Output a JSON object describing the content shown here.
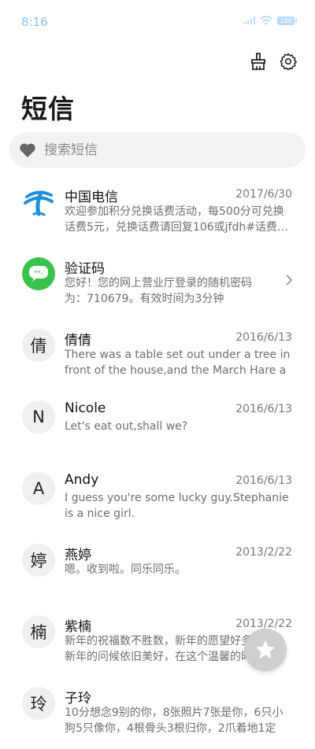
{
  "status_bar": {
    "time": "8:16",
    "battery": "100"
  },
  "page_title": "短信",
  "search": {
    "placeholder": "搜索短信"
  },
  "messages": [
    {
      "name": "中国电信",
      "date": "2017/6/30",
      "preview": "欢迎参加积分兑换话费活动，每500分可兑换话费5元，兑换话费请回复106或jfdh#话费…",
      "avatar_icon": "china-telecom-logo-icon"
    },
    {
      "name": "验证码",
      "date": "",
      "preview": "您好！您的网上营业厅登录的随机密码为：710679。有效时间为3分钟",
      "avatar_icon": "message-bubble-icon"
    },
    {
      "name": "倩倩",
      "date": "2016/6/13",
      "preview": "There was a table set out under a tree in front of the house,and the March Hare an…",
      "avatar_letter": "倩"
    },
    {
      "name": "Nicole",
      "date": "2016/6/13",
      "preview": "Let's eat out,shall we?",
      "avatar_letter": "N"
    },
    {
      "name": "Andy",
      "date": "2016/6/13",
      "preview": "I guess you're some lucky guy.Stephanie is a nice girl.",
      "avatar_letter": "A"
    },
    {
      "name": "燕婷",
      "date": "2013/2/22",
      "preview": "嗯。收到啦。同乐同乐。",
      "avatar_letter": "婷"
    },
    {
      "name": "紫楠",
      "date": "2013/2/22",
      "preview": "新年的祝福数不胜数，新年的愿望好多好多，新年的问候依旧美好，在这个温馨的时刻，…",
      "avatar_letter": "楠"
    },
    {
      "name": "子玲",
      "date": "",
      "preview": "10分想念9别的你，8张照片7张是你，6只小狗5只像你，4根骨头3根归你，2爪着地1定",
      "avatar_letter": "玲"
    }
  ],
  "colors": {
    "accent": "#1f8fd8",
    "wechat_green": "#3ac34c",
    "fab": "#cfcfcf"
  }
}
